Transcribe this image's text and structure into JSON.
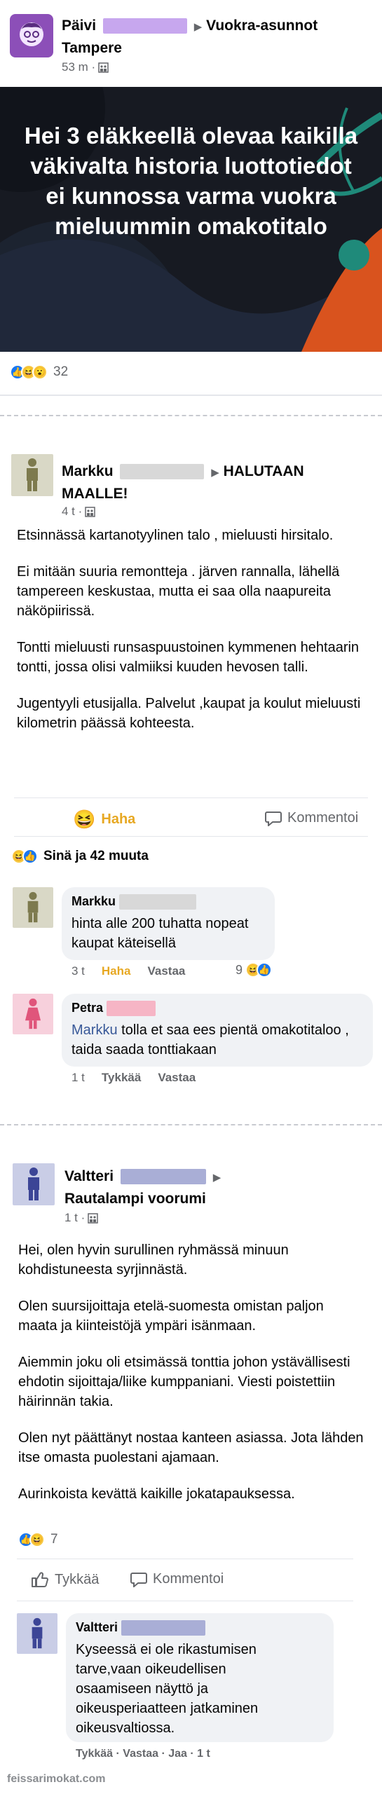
{
  "post1": {
    "author": "Päivi",
    "arrow": "▶",
    "group_line1": "Vuokra-asunnot",
    "group_line2": "Tampere",
    "time": "53 m ·",
    "banner_text": "Hei 3 eläkkeellä olevaa kaikilla väkivalta historia luottotiedot ei kunnossa varma vuokra mieluummin omakotitalo",
    "reaction_count": "32",
    "colors": {
      "avatar_bg": "#8c4fb8",
      "redact": "#c7a7ee",
      "banner_bg": "#171a22",
      "banner_accent": "#1f8a7a",
      "banner_orange": "#d9531e"
    }
  },
  "post2": {
    "author": "Markku",
    "arrow": "▶",
    "group_line1": "HALUTAAN",
    "group_line2": "MAALLE!",
    "time": "4 t ·",
    "paragraphs": [
      "Etsinnässä kartanotyylinen talo , mieluusti hirsitalo.",
      "Ei mitään suuria remontteja . järven rannalla, lähellä tampereen keskustaa, mutta ei saa olla naapureita näköpiirissä.",
      "Tontti mieluusti runsaspuustoinen kymmenen hehtaarin tontti, jossa olisi valmiiksi kuuden hevosen talli.",
      "Jugentyyli etusijalla. Palvelut ,kaupat ja koulut mieluusti kilometrin päässä kohteesta."
    ],
    "action_haha": "Haha",
    "action_comment": "Kommentoi",
    "reactions_text": "Sinä ja 42 muuta",
    "colors": {
      "redact": "#d8d8d8",
      "avatar_bg": "#d9d8c6",
      "figure": "#7d7a4e",
      "haha": "#e7a823"
    },
    "comments": [
      {
        "author": "Markku",
        "text": "hinta alle 200 tuhatta nopeat kaupat käteisellä",
        "time": "3 t",
        "like": "Haha",
        "reply": "Vastaa",
        "react_count": "9"
      },
      {
        "author": "Petra",
        "mention": "Markku",
        "text": " tolla et saa ees pientä omakotitaloo , taida saada tonttiakaan",
        "time": "1 t",
        "like": "Tykkää",
        "reply": "Vastaa"
      }
    ]
  },
  "post3": {
    "author": "Valtteri",
    "arrow": "▶",
    "group_line": "Rautalampi voorumi",
    "time": "1 t ·",
    "paragraphs": [
      "Hei, olen hyvin surullinen ryhmässä minuun kohdistuneesta syrjinnästä.",
      "Olen suursijoittaja etelä-suomesta omistan paljon maata ja kiinteistöjä ympäri isänmaan.",
      "Aiemmin joku oli etsimässä tonttia johon ystävällisesti ehdotin sijoittaja/liike kumppaniani. Viesti poistettiin häirinnän takia.",
      "Olen nyt päättänyt nostaa kanteen asiassa. Jota lähden itse omasta puolestani ajamaan.",
      "Aurinkoista kevättä kaikille jokatapauksessa."
    ],
    "reaction_count": "7",
    "action_like": "Tykkää",
    "action_comment": "Kommentoi",
    "colors": {
      "redact": "#a9aed6",
      "avatar_bg": "#c9cde6",
      "figure": "#3c4596"
    },
    "comment": {
      "author": "Valtteri",
      "text": "Kyseessä ei ole rikastumisen tarve,vaan oikeudellisen osaamiseen näyttö ja oikeusperiaatteen jatkaminen oikeusvaltiossa.",
      "actions": "Tykkää · Vastaa · Jaa · 1 t"
    }
  },
  "petra_colors": {
    "redact": "#f6b5c5",
    "avatar_bg": "#f7d0dc",
    "figure": "#e0557b"
  },
  "watermark": "feissarimokat.com"
}
